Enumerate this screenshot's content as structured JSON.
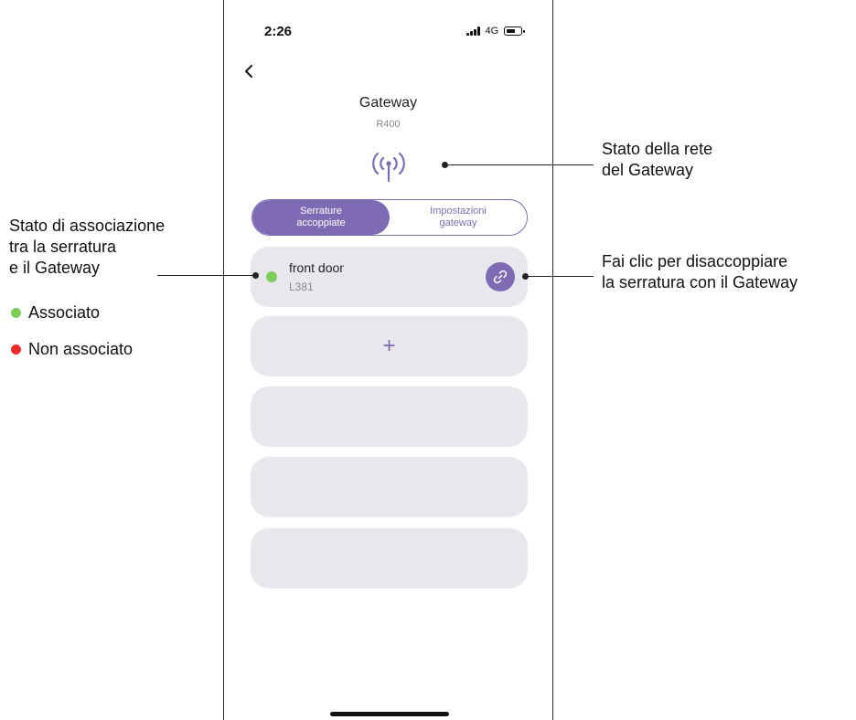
{
  "status_bar": {
    "time": "2:26",
    "network": "4G"
  },
  "header": {
    "title": "Gateway",
    "subtitle": "R400"
  },
  "icons": {
    "back": "chevron-left-icon",
    "network": "antenna-signal-icon",
    "unlink": "link-icon",
    "add": "plus-icon"
  },
  "tabs": [
    {
      "label": "Serrature\naccoppiate",
      "active": true
    },
    {
      "label": "Impostazioni\ngateway",
      "active": false
    }
  ],
  "device": {
    "name": "front door",
    "model": "L381",
    "status": "associated"
  },
  "add_button": {
    "label": "+"
  },
  "annotations": {
    "network_status": "Stato della rete\ndel Gateway",
    "association_status": "Stato di associazione\ntra la serratura\ne il Gateway",
    "unlink_hint": "Fai clic per disaccoppiare\nla serratura con il Gateway",
    "legend": [
      {
        "label": "Associato",
        "color": "#7fcc5b"
      },
      {
        "label": "Non associato",
        "color": "#ee2a2a"
      }
    ]
  },
  "colors": {
    "accent": "#7e6bb3",
    "card": "#e9e7ee",
    "associated": "#7fcc5b",
    "not_associated": "#ee2a2a"
  }
}
